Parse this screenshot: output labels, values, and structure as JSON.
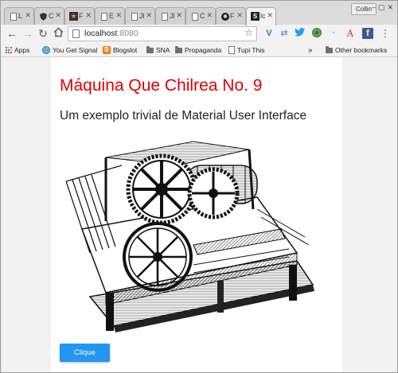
{
  "browser": {
    "tabs": [
      {
        "title": "L",
        "favicon": "page-icon"
      },
      {
        "title": "C",
        "favicon": "shield-icon"
      },
      {
        "title": "F",
        "favicon": "star-logo-icon"
      },
      {
        "title": "E",
        "favicon": "page-icon"
      },
      {
        "title": "Jl",
        "favicon": "page-icon"
      },
      {
        "title": "Jl",
        "favicon": "page-icon"
      },
      {
        "title": "C",
        "favicon": "page-icon"
      },
      {
        "title": "F",
        "favicon": "github-icon"
      },
      {
        "title": "lc",
        "favicon": "s-logo-icon",
        "active": true
      }
    ],
    "profile_label": "Collin",
    "address": {
      "host": "localhost",
      "port": ":8080"
    },
    "bookmarks": [
      {
        "label": "Apps",
        "icon": "apps-icon"
      },
      {
        "label": "You Get Signal",
        "icon": "globe-icon"
      },
      {
        "label": "Blogslot",
        "icon": "blogger-icon"
      },
      {
        "label": "SNA",
        "icon": "folder-icon"
      },
      {
        "label": "Propaganda",
        "icon": "folder-icon"
      },
      {
        "label": "Tupi This",
        "icon": "page-icon"
      }
    ],
    "more_bookmarks": "»",
    "other_bookmarks": "Other bookmarks",
    "accent_colors": {
      "twitter": "#1da1f2",
      "facebook": "#3b5998",
      "font_a": "#d32f2f",
      "ext_v": "#2a7fbf"
    }
  },
  "page": {
    "title": "Máquina Que Chilrea No. 9",
    "subtitle": "Um exemplo trivial de Material User Interface",
    "image_alt": "printing-press-engraving",
    "button_label": "Clique",
    "colors": {
      "title": "#e00000",
      "button": "#2196f3"
    }
  }
}
